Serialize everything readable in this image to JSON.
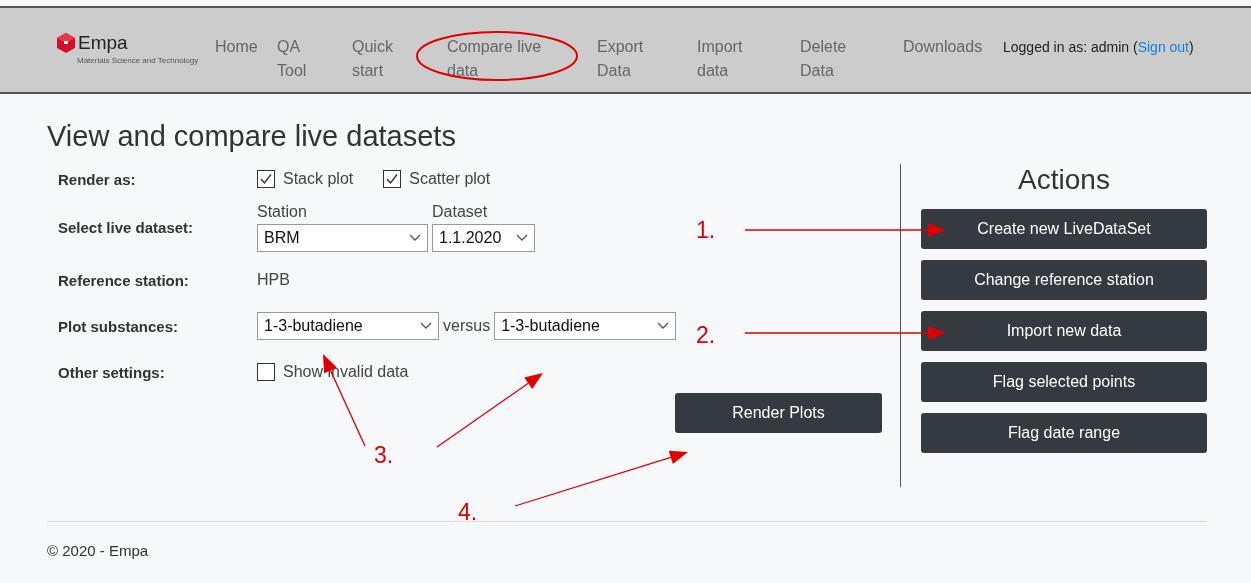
{
  "logo": {
    "name": "Empa",
    "tagline": "Materials Science and Technology"
  },
  "nav": [
    {
      "label": "Home"
    },
    {
      "label": "QA Tool"
    },
    {
      "label": "Quick start"
    },
    {
      "label": "Compare live data"
    },
    {
      "label": "Export Data"
    },
    {
      "label": "Import data"
    },
    {
      "label": "Delete Data"
    },
    {
      "label": "Downloads"
    }
  ],
  "login": {
    "text": "Logged in as: admin (",
    "link": "Sign out",
    "suffix": ")"
  },
  "page_title": "View and compare live datasets",
  "form_rows": [
    {
      "kind": "checkboxes",
      "label": "Render as:",
      "options": [
        {
          "label": "Stack plot",
          "checked": true
        },
        {
          "label": "Scatter plot",
          "checked": true
        }
      ]
    },
    {
      "kind": "selects",
      "label": "Select live dataset:",
      "fields": [
        {
          "caption": "Station",
          "value": "BRM"
        },
        {
          "caption": "Dataset",
          "value": "1.1.2020"
        }
      ]
    },
    {
      "kind": "text",
      "label": "Reference station:",
      "value": "HPB"
    },
    {
      "kind": "versus",
      "label": "Plot substances:",
      "joiner": "versus",
      "fields": [
        {
          "value": "1-3-butadiene"
        },
        {
          "value": "1-3-butadiene"
        }
      ]
    },
    {
      "kind": "checkboxes",
      "label": "Other settings:",
      "options": [
        {
          "label": "Show invalid data",
          "checked": false
        }
      ]
    }
  ],
  "render_button": "Render Plots",
  "actions": {
    "title": "Actions",
    "buttons": [
      "Create new LiveDataSet",
      "Change reference station",
      "Import new data",
      "Flag selected points",
      "Flag date range"
    ]
  },
  "footer": "© 2020 - Empa",
  "annotations": [
    "1.",
    "2.",
    "3.",
    "4."
  ]
}
